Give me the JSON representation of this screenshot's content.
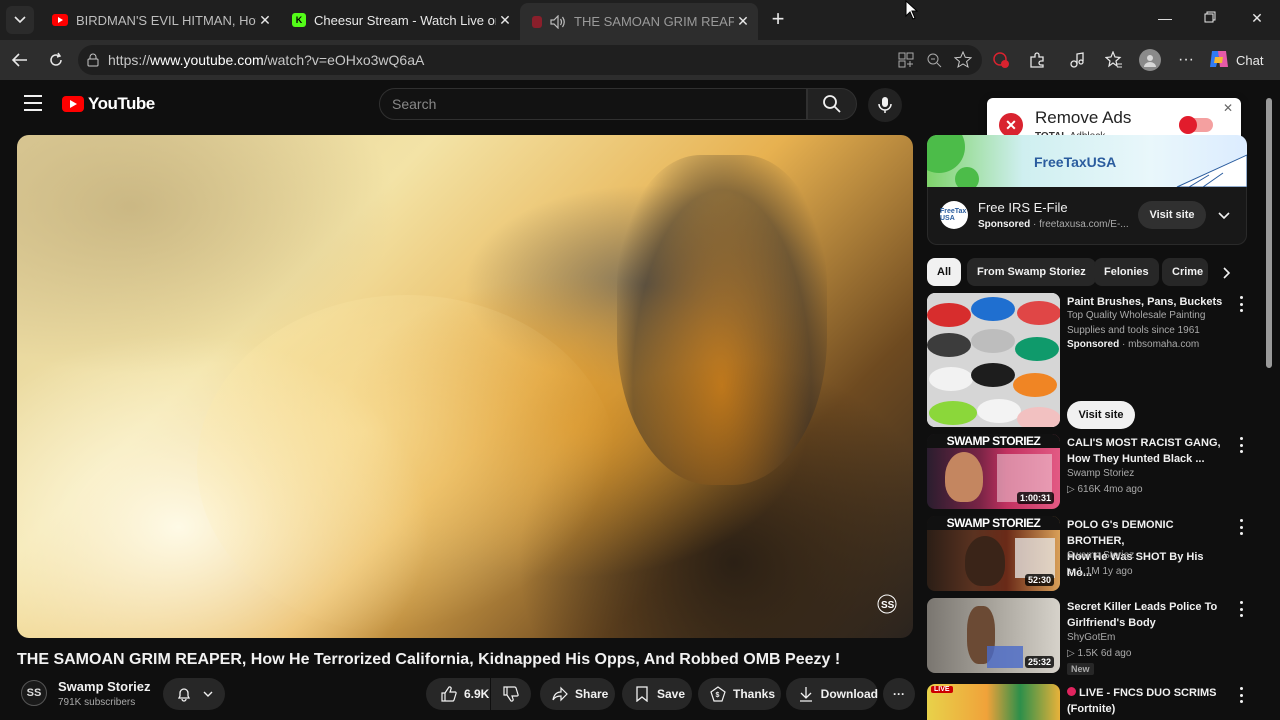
{
  "browser": {
    "tabs": [
      {
        "title": "BIRDMAN'S EVIL HITMAN, How H",
        "favicon": "youtube"
      },
      {
        "title": "Cheesur Stream - Watch Live on Ki",
        "favicon": "kick"
      },
      {
        "title": "THE SAMOAN GRIM REAPER,",
        "favicon": "youtube"
      }
    ],
    "url_prefix": "https://",
    "url_host": "www.youtube.com",
    "url_path": "/watch?v=eOHxo3wQ6aA",
    "chat_label": "Chat"
  },
  "youtube": {
    "logo_text": "YouTube",
    "search_placeholder": "Search"
  },
  "video": {
    "title": "THE SAMOAN GRIM REAPER, How He Terrorized California, Kidnapped His Opps, And Robbed OMB Peezy !",
    "channel": "Swamp Storiez",
    "subscribers": "791K subscribers",
    "likes": "6.9K",
    "share": "Share",
    "save": "Save",
    "thanks": "Thanks",
    "download": "Download"
  },
  "adblock": {
    "title": "Remove Ads",
    "brand_bold": "TOTAL",
    "brand_rest": "Adblock"
  },
  "ad": {
    "banner_brand": "FreeTaxUSA",
    "name": "Free IRS E-File",
    "sponsored": "Sponsored",
    "domain": "freetaxusa.com/E-...",
    "visit": "Visit site",
    "logo_text": "FreeTax USA"
  },
  "chips": [
    "All",
    "From Swamp Storiez",
    "Felonies",
    "Crime"
  ],
  "recommendations": [
    {
      "title_1": "Paint Brushes, Pans, Buckets",
      "line1": "Top Quality Wholesale Painting",
      "line2": "Supplies and tools since 1961",
      "sponsored": "Sponsored",
      "domain": "mbsomaha.com",
      "visit": "Visit site"
    },
    {
      "title_1": "CALI'S MOST RACIST GANG,",
      "title_2": "How They Hunted Black ...",
      "channel": "Swamp Storiez",
      "stats": "616K  4mo ago",
      "duration": "1:00:31",
      "thumb_label": "SWAMP STORIEZ"
    },
    {
      "title_1": "POLO G's DEMONIC BROTHER,",
      "title_2": "How He Was SHOT By His Mo...",
      "channel": "Swamp Storiez",
      "stats": "1.1M  1y ago",
      "duration": "52:30",
      "thumb_label": "SWAMP STORIEZ"
    },
    {
      "title_1": "Secret Killer Leads Police To",
      "title_2": "Girlfriend's Body",
      "channel": "ShyGotEm",
      "stats": "1.5K  6d ago",
      "duration": "25:32",
      "badge": "New"
    },
    {
      "title_1": "LIVE - FNCS DUO SCRIMS",
      "title_2": "(Fortnite)",
      "live_badge": "LIVE"
    }
  ]
}
